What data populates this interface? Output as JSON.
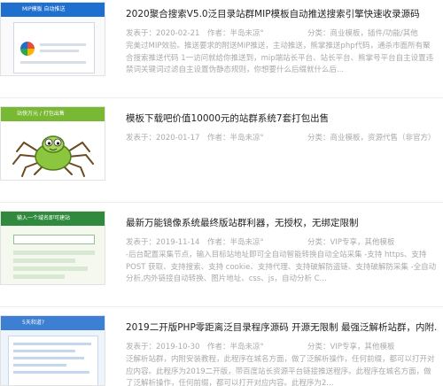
{
  "posts": [
    {
      "thumb_text": "MIP模板 自动推送",
      "title": "2020聚合搜索V5.0泛目录站群MIP模板自动推送搜索引擎快速收录源码",
      "date": "发表于：2020-02-21",
      "author": "作者：半岛未凉°",
      "category": "分类：商业模板，插件/功能/其他",
      "excerpt": "完美过MIP效验。推送要求的附送MIP推送，主动推送，熊掌推送php代码，通杀市面所有聚合搜索推送代码 1一访问就给你推送到，mip端站长平台、站长平台、熊掌号平台自主设置违禁词关键词过滤自主设置伪静态规则，你想要什么后缀就什么后..."
    },
    {
      "thumb_text": "站快万元 / 打包出售",
      "title": "模板下载吧价值10000元的站群系统7套打包出售",
      "date": "发表于：2020-01-17",
      "author": "作者：半岛未凉°",
      "category": "分类：商业模板，资源代售（非官方）",
      "excerpt": ""
    },
    {
      "thumb_text": "输入一个域名即可建站",
      "title": "最新万能镜像系统最终版站群利器，无授权，无绑定限制",
      "date": "发表于：2019-11-14",
      "author": "作者：半岛未凉°",
      "category": "分类：VIP专享，其他模板",
      "excerpt": "-后台配置采集节点，输入目标站地址即可全自动智能转换自动全站采集 -支持 https、支持 POST 获取、支持搜索、支持 cookie、支持代理、支持破解防盗链、支持破解防采集 -全自动分析,内外链接自动转换、图片地址、css、js，自动分析 C..."
    },
    {
      "thumb_text": "5天和道?",
      "title": "2019二开版PHP零距离泛目录程序源码 开源无限制 最强泛解析站群，内附...",
      "date": "发表于：2019-10-30",
      "author": "作者：半岛未凉°",
      "category": "分类：VIP专享，其他模板",
      "excerpt": "泛解析站群，内附安装教程，此程序在城名方面，做了泛解析操作，任何前缀，都可以打开对应内容。此程序为2019二开版，带百度站长资源平台链接推送程序。此程序在城名方面，做了泛解析操作，任何前缀，都可以打开对应内容。此程序为2..."
    }
  ],
  "colors": {
    "title": "#222222",
    "meta": "#aaaaaa",
    "mip_blue": "#1f6fcf",
    "green": "#79b833"
  }
}
